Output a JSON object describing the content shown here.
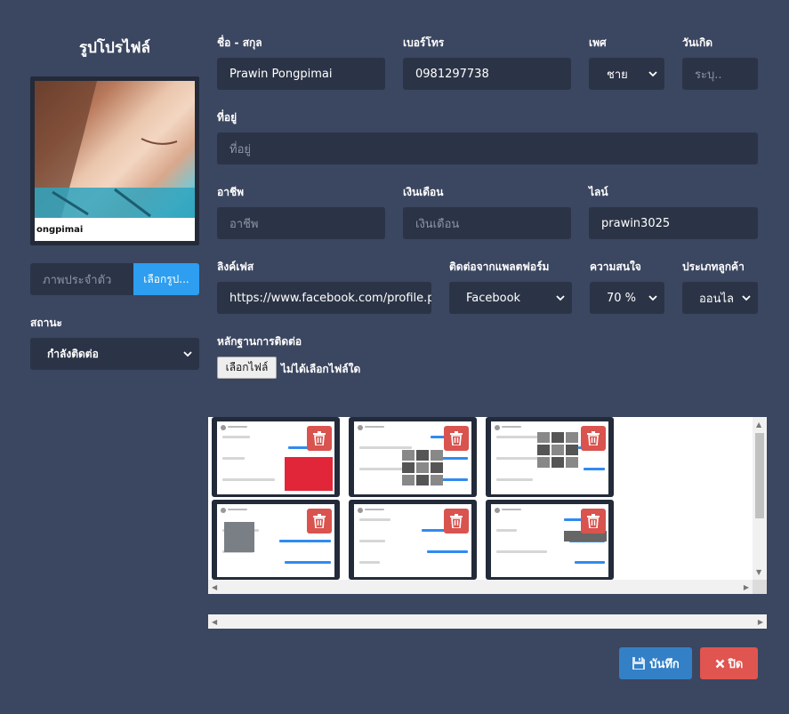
{
  "profile": {
    "title": "รูปโปรไฟล์",
    "name_caption": "ongpimai",
    "image_placeholder": "ภาพประจำตัว",
    "upload_label": "เลือกรูป..."
  },
  "status": {
    "label": "สถานะ",
    "value": "กำลังติดต่อ"
  },
  "fields": {
    "fullname": {
      "label": "ชื่อ - สกุล",
      "value": "Prawin Pongpimai"
    },
    "phone": {
      "label": "เบอร์โทร",
      "value": "0981297738"
    },
    "gender": {
      "label": "เพศ",
      "value": "ชาย"
    },
    "birthday": {
      "label": "วันเกิด",
      "placeholder": "ระบุ.."
    },
    "address": {
      "label": "ที่อยู่",
      "placeholder": "ที่อยู่"
    },
    "occupation": {
      "label": "อาชีพ",
      "placeholder": "อาชีพ"
    },
    "salary": {
      "label": "เงินเดือน",
      "placeholder": "เงินเดือน"
    },
    "line": {
      "label": "ไลน์",
      "value": "prawin3025"
    },
    "facebook": {
      "label": "ลิงค์เฟส",
      "value": "https://www.facebook.com/profile.pl"
    },
    "platform": {
      "label": "ติดต่อจากแพลตฟอร์ม",
      "value": "Facebook"
    },
    "interest": {
      "label": "ความสนใจ",
      "value": "70 %"
    },
    "customer_type": {
      "label": "ประเภทลูกค้า",
      "value": "ออนไล"
    }
  },
  "evidence": {
    "label": "หลักฐานการติดต่อ",
    "file_button": "เลือกไฟล์",
    "file_status": "ไม่ได้เลือกไฟล์ใด",
    "thumbnails": [
      "chat-1",
      "chat-2",
      "chat-3",
      "chat-4",
      "chat-5",
      "chat-6"
    ]
  },
  "actions": {
    "save": "บันทึก",
    "close": "ปิด"
  },
  "colors": {
    "background": "#3b4660",
    "field": "#2b3446",
    "primary": "#2d9ef0",
    "save": "#3380c6",
    "danger": "#d9534f",
    "messenger_blue": "#2f8bf0"
  }
}
